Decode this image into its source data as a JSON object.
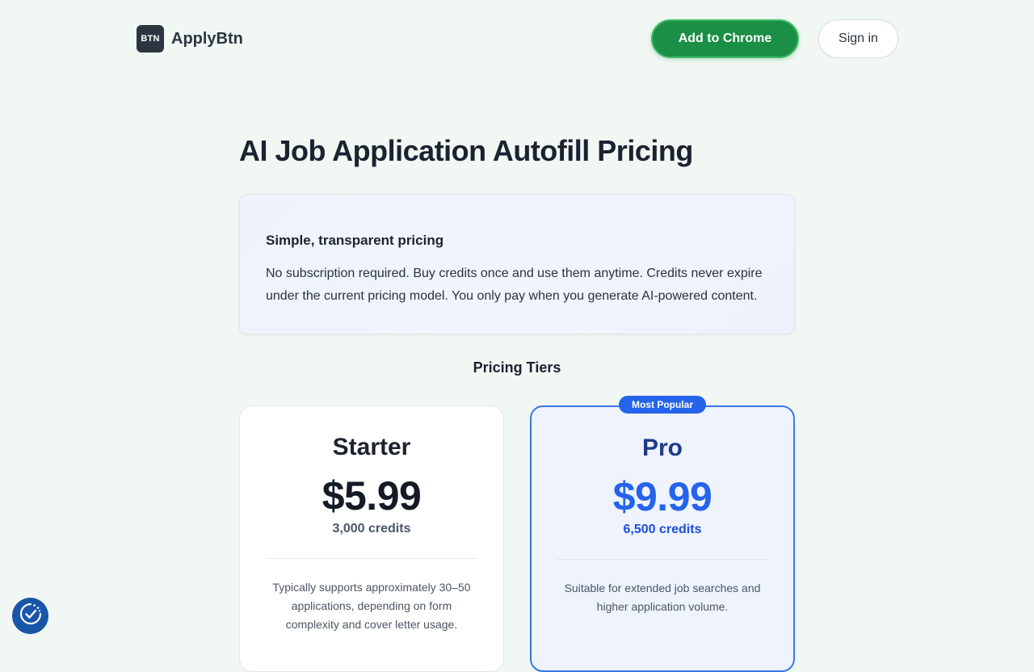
{
  "header": {
    "logo_text": "BTN",
    "brand_name": "ApplyBtn",
    "add_to_chrome_label": "Add to Chrome",
    "sign_in_label": "Sign in"
  },
  "main": {
    "title": "AI Job Application Autofill Pricing",
    "info": {
      "heading": "Simple, transparent pricing",
      "text": "No subscription required. Buy credits once and use them anytime. Credits never expire under the current pricing model. You only pay when you generate AI-powered content."
    },
    "tiers_heading": "Pricing Tiers",
    "tiers": [
      {
        "name": "Starter",
        "price": "$5.99",
        "credits": "3,000 credits",
        "description": "Typically supports approximately 30–50 applications, depending on form complexity and cover letter usage."
      },
      {
        "name": "Pro",
        "badge": "Most Popular",
        "price": "$9.99",
        "credits": "6,500 credits",
        "description": "Suitable for extended job searches and higher application volume."
      }
    ]
  },
  "consent_widget": {
    "icon": "cookie-consent-icon"
  },
  "colors": {
    "background": "#f1f7f3",
    "accent_green": "#1a8f45",
    "accent_blue": "#2563eb",
    "brand_dark": "#2d3540",
    "consent_blue": "#1856a8"
  }
}
